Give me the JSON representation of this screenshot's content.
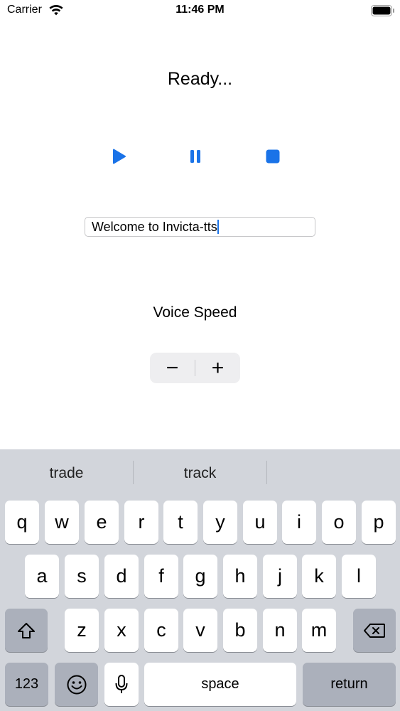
{
  "status_bar": {
    "carrier": "Carrier",
    "time": "11:46 PM"
  },
  "player": {
    "status": "Ready...",
    "controls": [
      "play",
      "pause",
      "stop"
    ],
    "accent_color": "#1a73e8"
  },
  "text_field": {
    "value": "Welcome to Invicta-tts"
  },
  "voice_speed": {
    "label": "Voice Speed",
    "decrement": "−",
    "increment": "+"
  },
  "keyboard": {
    "suggestions": [
      "trade",
      "track",
      ""
    ],
    "row1": [
      "q",
      "w",
      "e",
      "r",
      "t",
      "y",
      "u",
      "i",
      "o",
      "p"
    ],
    "row2": [
      "a",
      "s",
      "d",
      "f",
      "g",
      "h",
      "j",
      "k",
      "l"
    ],
    "row3": [
      "z",
      "x",
      "c",
      "v",
      "b",
      "n",
      "m"
    ],
    "numbers_key": "123",
    "space_key": "space",
    "return_key": "return",
    "icons": [
      "shift-icon",
      "backspace-icon",
      "emoji-icon",
      "microphone-icon"
    ]
  }
}
